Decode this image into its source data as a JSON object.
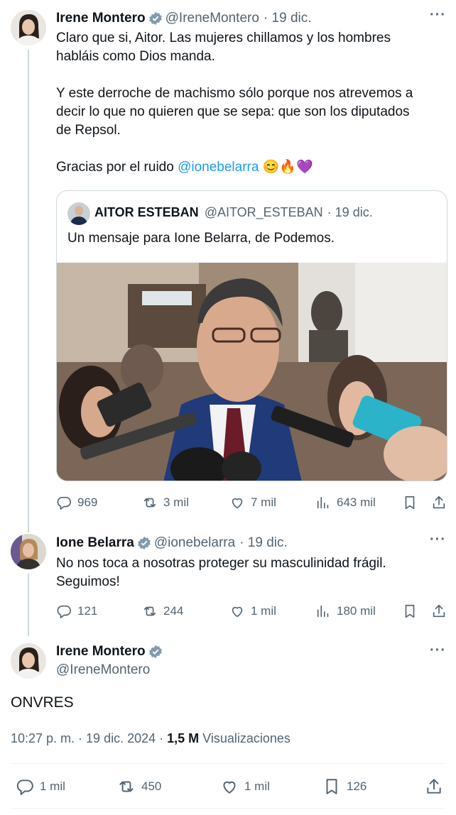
{
  "tweet1": {
    "name": "Irene Montero",
    "handle": "@IreneMontero",
    "date": "· 19 dic.",
    "line1": "Claro que si, Aitor. Las mujeres chillamos y los hombres",
    "line2": "habláis como Dios manda.",
    "line3": "Y este derroche de machismo sólo porque nos atrevemos a",
    "line4": "decir lo que no quieren que se sepa: que son los diputados",
    "line5": "de Repsol.",
    "line6_prefix": "Gracias por el ruido ",
    "mention": "@ionebelarra",
    "emojis": "😊🔥💜",
    "quote": {
      "name": "AITOR ESTEBAN",
      "handle": "@AITOR_ESTEBAN",
      "date": "· 19 dic.",
      "text": "Un mensaje para Ione Belarra, de Podemos."
    },
    "actions": {
      "replies": "969",
      "reposts": "3 mil",
      "likes": "7 mil",
      "views": "643 mil"
    }
  },
  "tweet2": {
    "name": "Ione Belarra",
    "handle": "@ionebelarra",
    "date": "· 19 dic.",
    "line1": "No nos toca a nosotras proteger su masculinidad frágil.",
    "line2": "Seguimos!",
    "actions": {
      "replies": "121",
      "reposts": "244",
      "likes": "1 mil",
      "views": "180 mil"
    }
  },
  "tweet3": {
    "name": "Irene Montero",
    "handle": "@IreneMontero",
    "text": "ONVRES",
    "timestamp": "10:27 p. m. · 19 dic. 2024 · ",
    "views_count": "1,5 M",
    "views_label": " Visualizaciones",
    "actions": {
      "replies": "1 mil",
      "reposts": "450",
      "likes": "1 mil",
      "bookmarks": "126"
    }
  },
  "colors": {
    "accent": "#1d9bf0",
    "text": "#0f1419",
    "muted": "#536471",
    "border": "#cfd9de"
  },
  "icons": [
    "verified-badge-icon",
    "more-icon",
    "reply-icon",
    "repost-icon",
    "like-icon",
    "views-icon",
    "bookmark-icon",
    "share-icon"
  ]
}
